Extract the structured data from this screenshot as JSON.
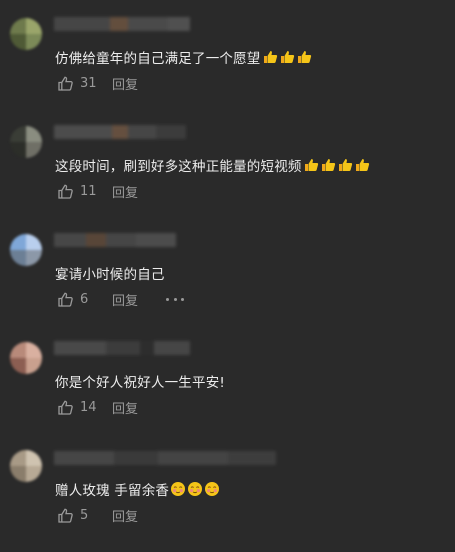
{
  "comments": [
    {
      "text": "仿佛给童年的自己满足了一个愿望",
      "emoji": "thumbs-up-emoji",
      "emoji_count": 3,
      "likes": "31",
      "reply_label": "回复",
      "has_more": false
    },
    {
      "text": "这段时间，刷到好多这种正能量的短视频",
      "emoji": "thumbs-up-emoji",
      "emoji_count": 4,
      "likes": "11",
      "reply_label": "回复",
      "has_more": false
    },
    {
      "text": "宴请小时候的自己",
      "emoji": "",
      "emoji_count": 0,
      "likes": "6",
      "reply_label": "回复",
      "has_more": true
    },
    {
      "text": "你是个好人祝好人一生平安!",
      "emoji": "",
      "emoji_count": 0,
      "likes": "14",
      "reply_label": "回复",
      "has_more": false
    },
    {
      "text": "赠人玫瑰 手留余香",
      "emoji": "blushing-face-emoji",
      "emoji_count": 3,
      "likes": "5",
      "reply_label": "回复",
      "has_more": false
    }
  ],
  "colors": {
    "background": "#2a2a2a",
    "text": "#ececec",
    "secondary": "#9a9a9a",
    "emoji_yellow": "#f5c518"
  },
  "icons": {
    "like": "thumbs-up-outline-icon",
    "more": "more-horizontal-icon"
  }
}
